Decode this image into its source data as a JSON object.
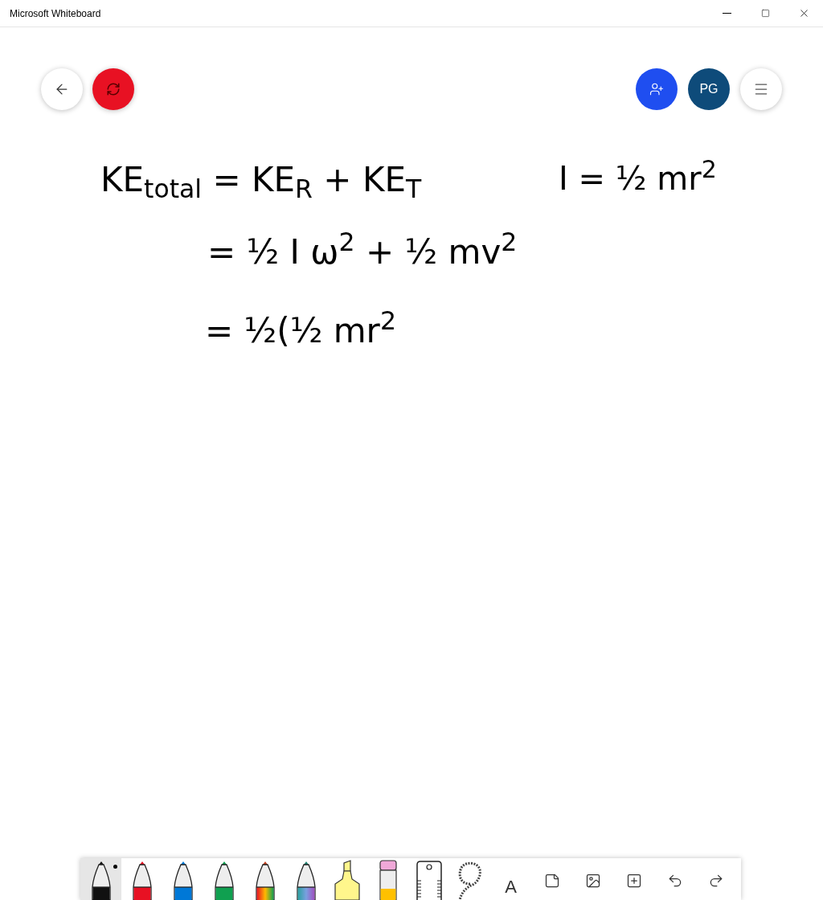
{
  "window": {
    "title": "Microsoft Whiteboard"
  },
  "header": {
    "user_initials": "PG"
  },
  "ink": [
    {
      "text": "KE$_{total}$ = KE$_{R}$ + KE$_{T}$",
      "kind": "line"
    },
    {
      "text": "= ½ I ω$^{2}$ + ½ mv$^{2}$",
      "kind": "line"
    },
    {
      "text": "= ½(½ mr$^{2}$",
      "kind": "line"
    },
    {
      "text": "I = ½ mr$^{2}$",
      "kind": "aside"
    }
  ],
  "tools": [
    {
      "kind": "pen",
      "color": "#111111",
      "selected": true
    },
    {
      "kind": "pen",
      "color": "#e81123",
      "selected": false
    },
    {
      "kind": "pen",
      "color": "#0078d7",
      "selected": false
    },
    {
      "kind": "pen",
      "color": "#10a050",
      "selected": false
    },
    {
      "kind": "rainbow",
      "selected": false
    },
    {
      "kind": "galaxy",
      "selected": false
    },
    {
      "kind": "highlighter",
      "color": "#fff68c",
      "selected": false
    },
    {
      "kind": "eraser",
      "selected": false
    },
    {
      "kind": "ruler",
      "selected": false
    },
    {
      "kind": "lasso",
      "selected": false
    },
    {
      "kind": "text",
      "label": "A",
      "selected": false
    },
    {
      "kind": "note",
      "selected": false
    },
    {
      "kind": "image",
      "selected": false
    },
    {
      "kind": "insert",
      "selected": false
    },
    {
      "kind": "undo",
      "selected": false
    },
    {
      "kind": "redo",
      "selected": false
    }
  ]
}
